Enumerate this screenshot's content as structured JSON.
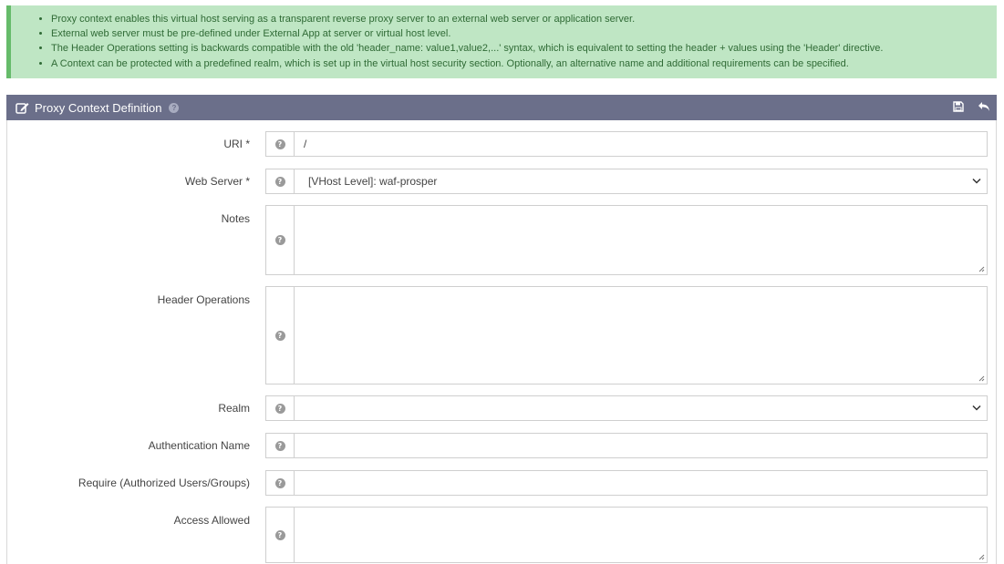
{
  "notice": {
    "items": [
      "Proxy context enables this virtual host serving as a transparent reverse proxy server to an external web server or application server.",
      "External web server must be pre-defined under External App at server or virtual host level.",
      "The Header Operations setting is backwards compatible with the old 'header_name: value1,value2,...' syntax, which is equivalent to setting the header + values using the 'Header' directive.",
      "A Context can be protected with a predefined realm, which is set up in the virtual host security section. Optionally, an alternative name and additional requirements can be specified."
    ]
  },
  "panel": {
    "title": "Proxy Context Definition",
    "help_glyph": "?",
    "save_icon": "save-icon",
    "back_icon": "undo-icon"
  },
  "form": {
    "help_glyph": "?",
    "uri": {
      "label": "URI *",
      "value": "/"
    },
    "web_server": {
      "label": "Web Server *",
      "value": "[VHost Level]: waf-prosper"
    },
    "notes": {
      "label": "Notes",
      "value": ""
    },
    "header_operations": {
      "label": "Header Operations",
      "value": ""
    },
    "realm": {
      "label": "Realm",
      "value": ""
    },
    "auth_name": {
      "label": "Authentication Name",
      "value": ""
    },
    "require": {
      "label": "Require (Authorized Users/Groups)",
      "value": ""
    },
    "access_allowed": {
      "label": "Access Allowed",
      "value": ""
    }
  },
  "colors": {
    "notice_bg": "#bfe6c4",
    "notice_accent": "#66bb6a",
    "header_bg": "#6b6f8a"
  }
}
